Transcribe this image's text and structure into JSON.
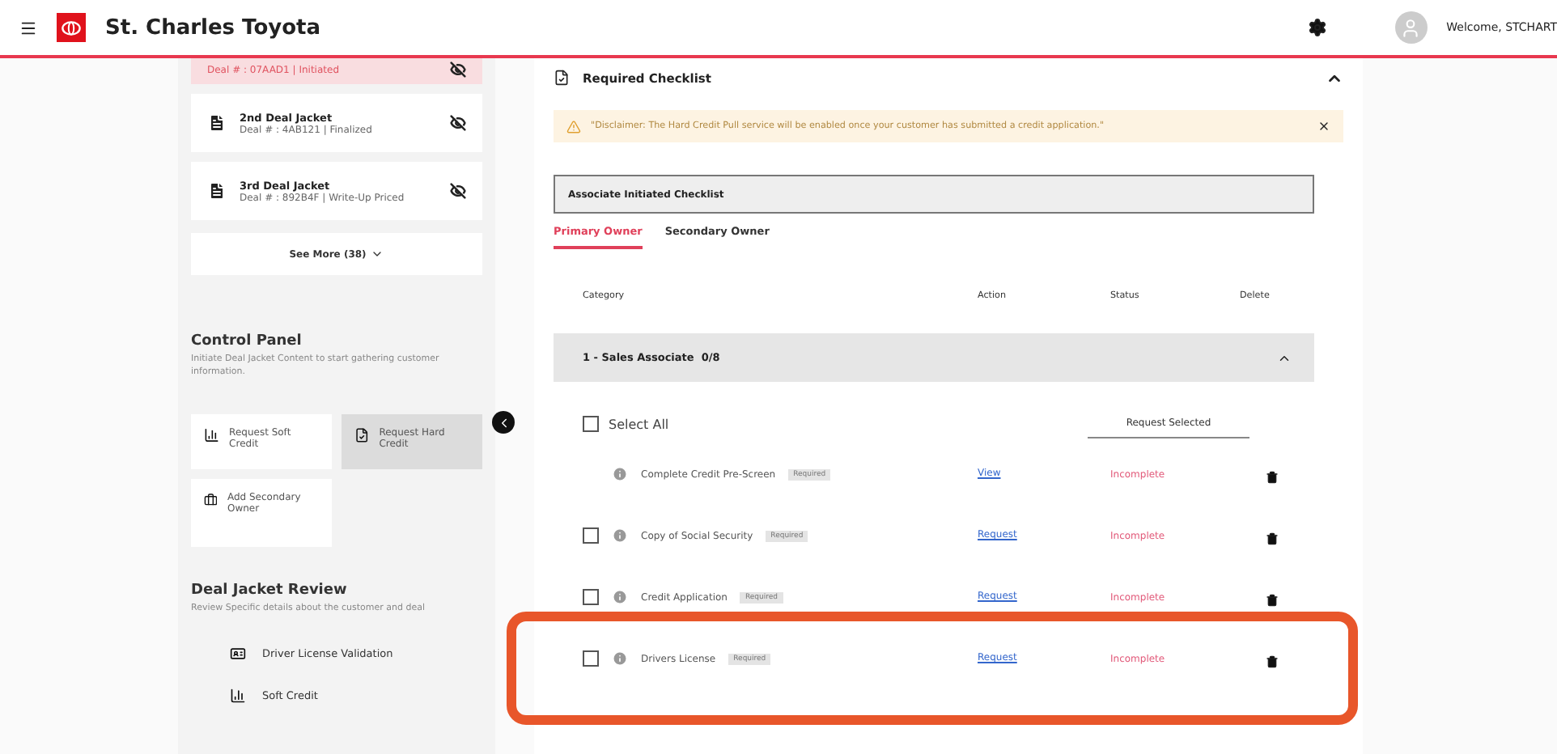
{
  "header": {
    "brand": "St. Charles Toyota",
    "welcome": "Welcome, STCHART"
  },
  "sidebar": {
    "deal_jackets": [
      {
        "subtitle": "Deal # : 07AAD1 | Initiated",
        "selected": true
      },
      {
        "title": "2nd Deal Jacket",
        "subtitle": "Deal # : 4AB121 | Finalized",
        "selected": false
      },
      {
        "title": "3rd Deal Jacket",
        "subtitle": "Deal # : 892B4F | Write-Up Priced",
        "selected": false
      }
    ],
    "see_more": "See More (38)",
    "control_panel": {
      "title": "Control Panel",
      "description": "Initiate Deal Jacket Content to start gathering customer information.",
      "actions": [
        {
          "kind": "soft",
          "label": "Request Soft Credit",
          "selected": false
        },
        {
          "kind": "hard",
          "label": "Request Hard Credit",
          "selected": true
        },
        {
          "kind": "owner",
          "label": "Add Secondary Owner",
          "selected": false
        }
      ]
    },
    "review": {
      "title": "Deal Jacket Review",
      "description": "Review Specific details about the customer and deal",
      "items": [
        {
          "kind": "license",
          "label": "Driver License Validation"
        },
        {
          "kind": "credit",
          "label": "Soft Credit"
        }
      ]
    }
  },
  "main": {
    "title": "Required Checklist",
    "expanded": true,
    "alert": "\"Disclaimer: The Hard Credit Pull service will be enabled once your customer has submitted a credit application.\"",
    "checklist_title": "Associate Initiated Checklist",
    "tabs": [
      {
        "label": "Primary Owner",
        "selected": true
      },
      {
        "label": "Secondary Owner",
        "selected": false
      }
    ],
    "columns": [
      "Category",
      "Action",
      "Status",
      "Delete"
    ],
    "group": {
      "title": "1 - Sales Associate",
      "count": "0/8",
      "expanded": true
    },
    "select_all": {
      "label": "Select All",
      "checked": false
    },
    "request_button": "Request Selected",
    "rows": [
      {
        "kind": "auto",
        "name": "Complete Credit Pre-Screen",
        "tag": "Required",
        "action": "View",
        "status": "Incomplete"
      },
      {
        "kind": "checkbox",
        "checked": false,
        "name": "Copy of Social Security",
        "tag": "Required",
        "action": "Request",
        "status": "Incomplete"
      },
      {
        "kind": "checkbox",
        "checked": false,
        "name": "Credit Application",
        "tag": "Required",
        "action": "Request",
        "status": "Incomplete"
      },
      {
        "kind": "checkbox",
        "checked": false,
        "name": "Drivers License",
        "tag": "Required",
        "action": "Request",
        "status": "Incomplete"
      }
    ]
  }
}
